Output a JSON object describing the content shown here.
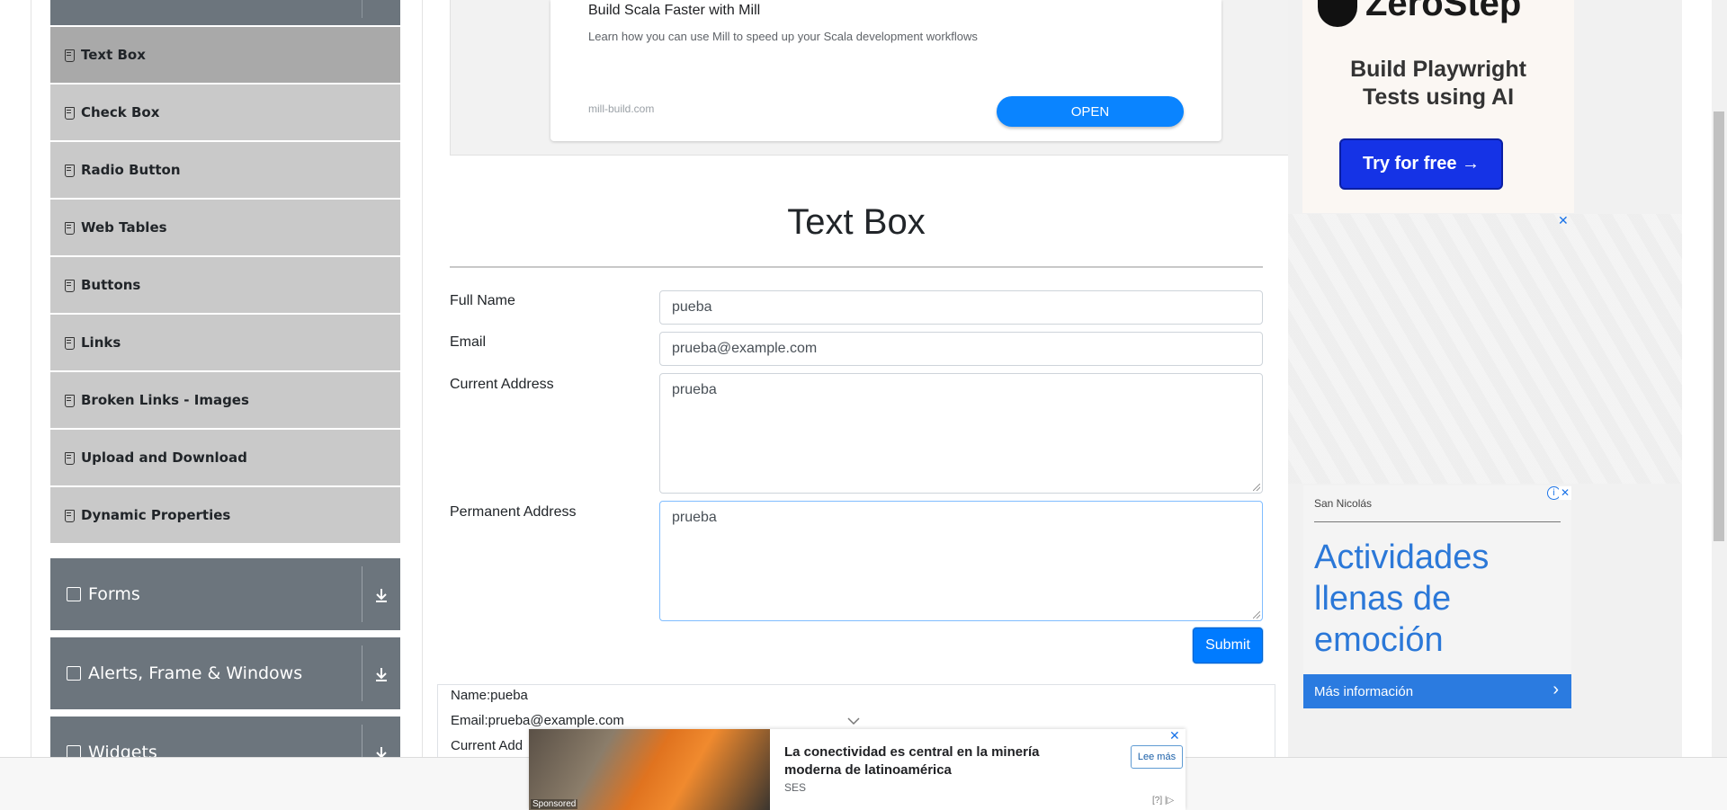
{
  "sidebar": {
    "items": [
      {
        "label": "Text Box",
        "active": true
      },
      {
        "label": "Check Box"
      },
      {
        "label": "Radio Button"
      },
      {
        "label": "Web Tables"
      },
      {
        "label": "Buttons"
      },
      {
        "label": "Links"
      },
      {
        "label": "Broken Links - Images"
      },
      {
        "label": "Upload and Download"
      },
      {
        "label": "Dynamic Properties"
      }
    ],
    "groups": [
      {
        "label": "Forms",
        "icon": "form-icon"
      },
      {
        "label": "Alerts, Frame & Windows",
        "icon": "window-icon"
      },
      {
        "label": "Widgets",
        "icon": "widgets-icon"
      }
    ]
  },
  "top_ad": {
    "title": "Build Scala Faster with Mill",
    "description": "Learn how you can use Mill to speed up your Scala development workflows",
    "url": "mill-build.com",
    "button": "OPEN"
  },
  "main": {
    "title": "Text Box",
    "form": {
      "full_name": {
        "label": "Full Name",
        "value": "pueba"
      },
      "email": {
        "label": "Email",
        "value": "prueba@example.com"
      },
      "current_address": {
        "label": "Current Address",
        "value": "prueba"
      },
      "permanent_address": {
        "label": "Permanent Address",
        "value": "prueba"
      },
      "submit": "Submit"
    },
    "output": {
      "name": "Name:pueba",
      "email": "Email:prueba@example.com",
      "current_address": "Current Add"
    }
  },
  "right_ads": {
    "zerostep": {
      "brand": "ZeroStep",
      "headline_1": "Build Playwright",
      "headline_2": "Tests using AI",
      "cta": "Try for free →"
    },
    "close_symbol": "✕",
    "san_nicolas": {
      "location": "San Nicolás",
      "headline": "Actividades llenas de emoción",
      "cta": "Más información",
      "chevron": "›",
      "info_symbol": "i",
      "close_symbol": "✕"
    }
  },
  "sponsored_ad": {
    "headline": "La conectividad es central en la minería moderna de latinoamérica",
    "source": "SES",
    "button": "Lee más",
    "sponsored_label": "Sponsored",
    "adchoices": "[?] |▷",
    "close_symbol": "✕"
  },
  "colors": {
    "sidebar_group": "#6c757d",
    "menu_item": "#c9c9c9",
    "menu_item_active": "#a9a9a9",
    "primary": "#007bff",
    "ad_open": "#0a84ff",
    "zerostep_cta": "#1533e6",
    "san_nicolas_blue": "#2b7be0"
  }
}
